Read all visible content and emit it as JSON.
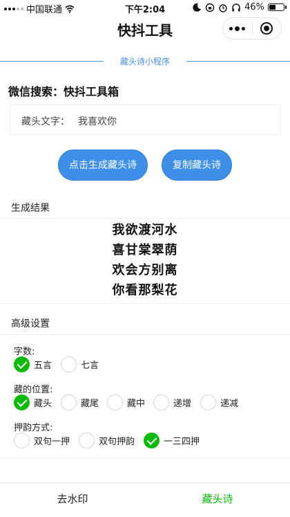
{
  "status_bar": {
    "carrier": "中国联通",
    "time": "下午2:04",
    "battery": "46%",
    "battery_level": 0.46
  },
  "nav": {
    "title": "快抖工具"
  },
  "banner": {
    "text": "藏头诗小程序",
    "color": "#4a90e2"
  },
  "wechat_search": "微信搜索：快抖工具箱",
  "input": {
    "label": "藏头文字：",
    "value": "我喜欢你"
  },
  "buttons": {
    "generate": "点击生成藏头诗",
    "copy": "复制藏头诗",
    "color": "#3d8fe8"
  },
  "result": {
    "title": "生成结果",
    "lines": [
      "我欲渡河水",
      "喜甘棠翠荫",
      "欢会方别离",
      "你看那梨花"
    ]
  },
  "settings": {
    "title": "高级设置",
    "word_count": {
      "label": "字数:",
      "options": [
        {
          "label": "五言",
          "checked": true
        },
        {
          "label": "七言",
          "checked": false
        }
      ]
    },
    "position": {
      "label": "藏的位置:",
      "options": [
        {
          "label": "藏头",
          "checked": true
        },
        {
          "label": "藏尾",
          "checked": false
        },
        {
          "label": "藏中",
          "checked": false
        },
        {
          "label": "递增",
          "checked": false
        },
        {
          "label": "递减",
          "checked": false
        }
      ]
    },
    "rhyme": {
      "label": "押韵方式:",
      "options": [
        {
          "label": "双句一押",
          "checked": false
        },
        {
          "label": "双句押韵",
          "checked": false
        },
        {
          "label": "一三四押",
          "checked": true
        }
      ]
    },
    "check_color": "#09bb07"
  },
  "tabs": [
    {
      "label": "去水印",
      "active": false
    },
    {
      "label": "藏头诗",
      "active": true
    }
  ]
}
